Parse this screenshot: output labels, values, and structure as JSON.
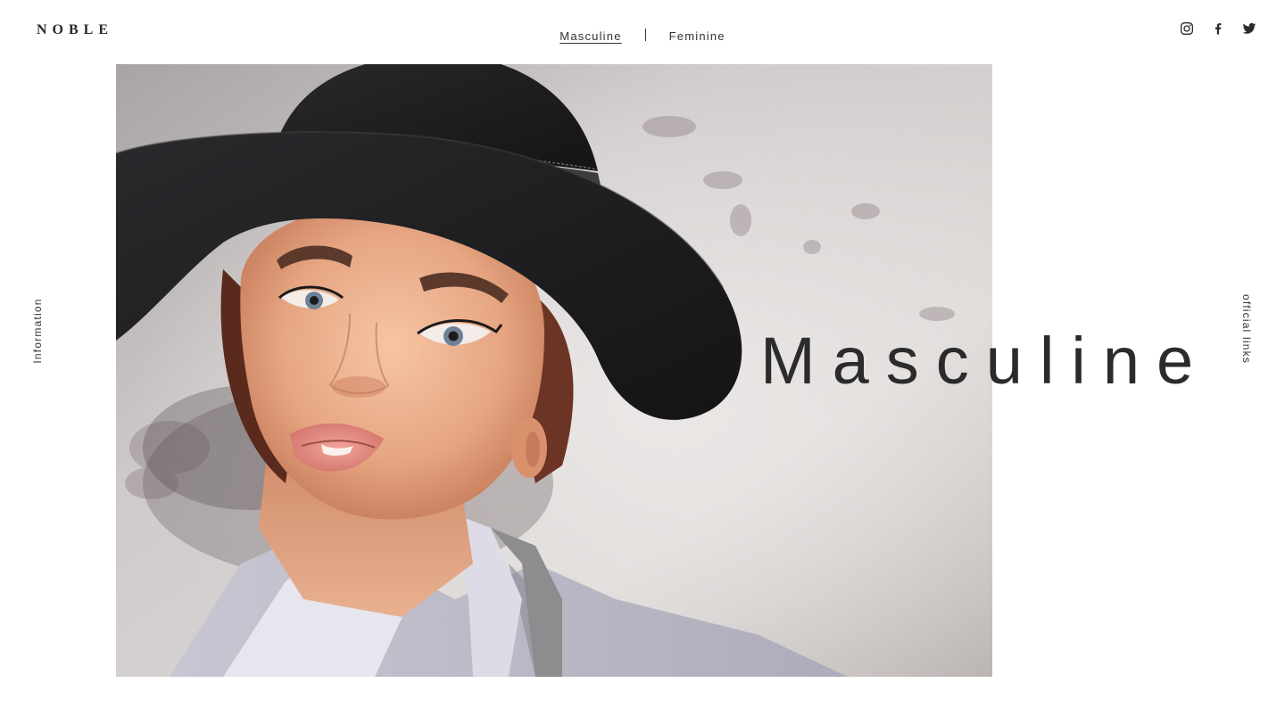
{
  "brand": {
    "logo_text": "NOBLE"
  },
  "nav": {
    "items": [
      {
        "label": "Masculine",
        "active": true
      },
      {
        "label": "Feminine",
        "active": false
      }
    ]
  },
  "social": {
    "icons": [
      "instagram-icon",
      "facebook-icon",
      "twitter-icon"
    ]
  },
  "side": {
    "left_label": "Information",
    "right_label": "official links"
  },
  "hero": {
    "title": "Masculine",
    "image_subject": "portrait-woman-black-wide-brim-hat"
  },
  "colors": {
    "text": "#2b2b2b",
    "background": "#ffffff"
  }
}
